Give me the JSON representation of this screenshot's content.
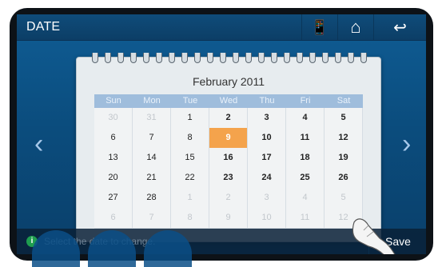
{
  "header": {
    "title": "DATE",
    "buttons": [
      {
        "name": "remote-icon",
        "symbol": "📱"
      },
      {
        "name": "home-icon",
        "symbol": "⌂"
      },
      {
        "name": "back-icon",
        "symbol": "↩"
      }
    ]
  },
  "calendar": {
    "month": "February 2011",
    "weekdays": [
      "Sun",
      "Mon",
      "Tue",
      "Wed",
      "Thu",
      "Fri",
      "Sat"
    ],
    "weeks": [
      [
        {
          "d": "30",
          "dim": true
        },
        {
          "d": "31",
          "dim": true
        },
        {
          "d": "1"
        },
        {
          "d": "2",
          "bold": true
        },
        {
          "d": "3",
          "bold": true
        },
        {
          "d": "4",
          "bold": true
        },
        {
          "d": "5",
          "bold": true
        }
      ],
      [
        {
          "d": "6"
        },
        {
          "d": "7"
        },
        {
          "d": "8"
        },
        {
          "d": "9",
          "sel": true
        },
        {
          "d": "10",
          "bold": true
        },
        {
          "d": "11",
          "bold": true
        },
        {
          "d": "12",
          "bold": true
        }
      ],
      [
        {
          "d": "13"
        },
        {
          "d": "14"
        },
        {
          "d": "15"
        },
        {
          "d": "16",
          "bold": true
        },
        {
          "d": "17",
          "bold": true
        },
        {
          "d": "18",
          "bold": true
        },
        {
          "d": "19",
          "bold": true
        }
      ],
      [
        {
          "d": "20"
        },
        {
          "d": "21"
        },
        {
          "d": "22"
        },
        {
          "d": "23",
          "bold": true
        },
        {
          "d": "24",
          "bold": true
        },
        {
          "d": "25",
          "bold": true
        },
        {
          "d": "26",
          "bold": true
        }
      ],
      [
        {
          "d": "27"
        },
        {
          "d": "28"
        },
        {
          "d": "1",
          "dim": true
        },
        {
          "d": "2",
          "dim": true
        },
        {
          "d": "3",
          "dim": true
        },
        {
          "d": "4",
          "dim": true
        },
        {
          "d": "5",
          "dim": true
        }
      ],
      [
        {
          "d": "6",
          "dim": true
        },
        {
          "d": "7",
          "dim": true
        },
        {
          "d": "8",
          "dim": true
        },
        {
          "d": "9",
          "dim": true
        },
        {
          "d": "10",
          "dim": true
        },
        {
          "d": "11",
          "dim": true
        },
        {
          "d": "12",
          "dim": true
        }
      ]
    ],
    "selected_color": "#f4a34c"
  },
  "navigation": {
    "prev_symbol": "‹",
    "next_symbol": "›"
  },
  "footer": {
    "info_symbol": "i",
    "hint": "Select the date to change.",
    "save_label": "Save"
  }
}
